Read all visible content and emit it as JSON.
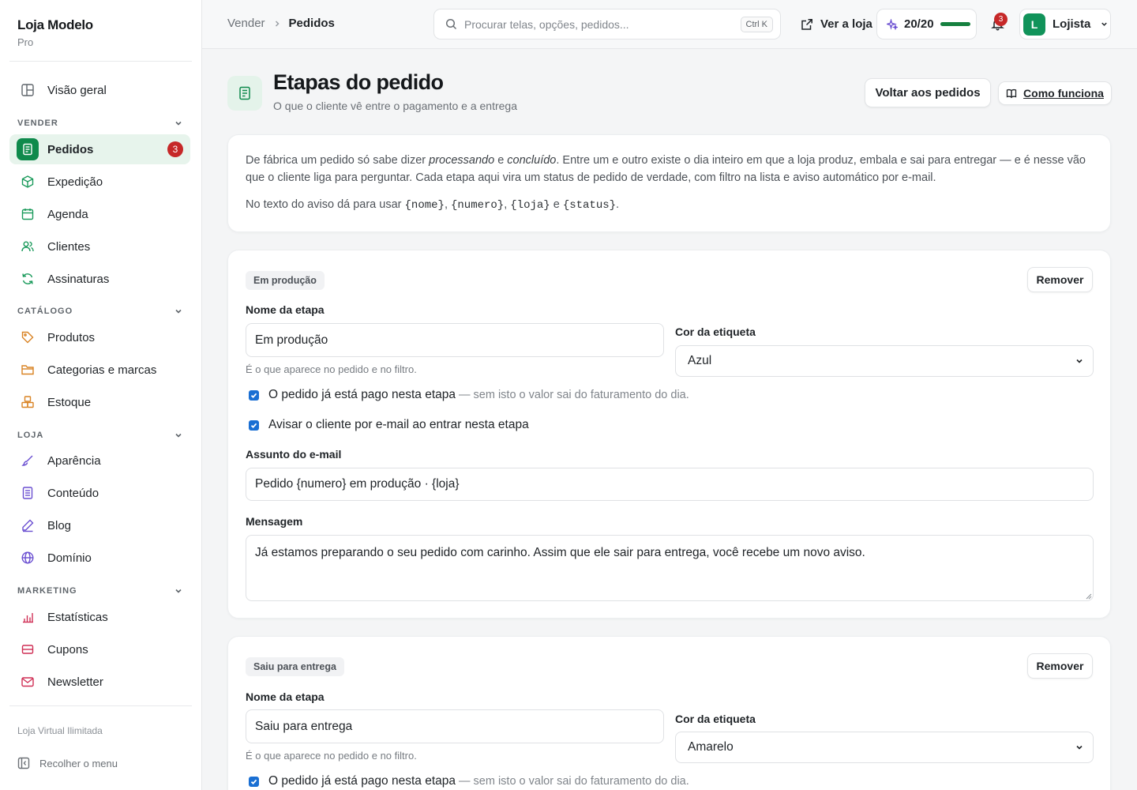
{
  "app": {
    "name": "Loja Modelo",
    "plan": "Pro"
  },
  "sidebar": {
    "overview": {
      "label": "Visão geral",
      "icon": "layout-icon"
    },
    "sections": [
      {
        "title": "VENDER",
        "items": [
          {
            "label": "Pedidos",
            "icon": "receipt-icon",
            "badge": "3",
            "active": true
          },
          {
            "label": "Expedição",
            "icon": "box-icon"
          },
          {
            "label": "Agenda",
            "icon": "calendar-icon"
          },
          {
            "label": "Clientes",
            "icon": "users-icon"
          },
          {
            "label": "Assinaturas",
            "icon": "refresh-icon"
          }
        ]
      },
      {
        "title": "CATÁLOGO",
        "items": [
          {
            "label": "Produtos",
            "icon": "tag-icon"
          },
          {
            "label": "Categorias e marcas",
            "icon": "folder-icon"
          },
          {
            "label": "Estoque",
            "icon": "boxes-icon"
          }
        ]
      },
      {
        "title": "LOJA",
        "items": [
          {
            "label": "Aparência",
            "icon": "brush-icon"
          },
          {
            "label": "Conteúdo",
            "icon": "document-icon"
          },
          {
            "label": "Blog",
            "icon": "pen-icon"
          },
          {
            "label": "Domínio",
            "icon": "globe-icon"
          }
        ]
      },
      {
        "title": "MARKETING",
        "items": [
          {
            "label": "Estatísticas",
            "icon": "bar-chart-icon"
          },
          {
            "label": "Cupons",
            "icon": "ticket-icon"
          },
          {
            "label": "Newsletter",
            "icon": "mail-icon"
          }
        ]
      }
    ],
    "footer_text": "Loja Virtual Ilimitada",
    "collapse_label": "Recolher o menu"
  },
  "topbar": {
    "breadcrumb": [
      "Vender",
      "Pedidos"
    ],
    "search_placeholder": "Procurar telas, opções, pedidos...",
    "search_shortcut": "Ctrl K",
    "view_store": "Ver a loja",
    "quota": "20/20",
    "quota_fraction": 1.0,
    "notifications": "3",
    "user": {
      "initial": "L",
      "name": "Lojista"
    }
  },
  "page": {
    "title": "Etapas do pedido",
    "subtitle": "O que o cliente vê entre o pagamento e a entrega",
    "back_button": "Voltar aos pedidos",
    "help_button": "Como funciona"
  },
  "intro": {
    "p1_a": "De fábrica um pedido só sabe dizer ",
    "p1_em1": "processando",
    "p1_b": " e ",
    "p1_em2": "concluído",
    "p1_c": ". Entre um e outro existe o dia inteiro em que a loja produz, embala e sai para entregar — e é nesse vão que o cliente liga para perguntar. Cada etapa aqui vira um status de pedido de verdade, com filtro na lista e aviso automático por e-mail.",
    "p2_a": "No texto do aviso dá para usar ",
    "vars": [
      "{nome}",
      "{numero}",
      "{loja}",
      "{status}"
    ],
    "sep": ", ",
    "and": " e ",
    "end": "."
  },
  "stage_labels": {
    "remove": "Remover",
    "name_label": "Nome da etapa",
    "name_hint": "É o que aparece no pedido e no filtro.",
    "color_label": "Cor da etiqueta",
    "paid_label": "O pedido já está pago nesta etapa",
    "paid_hint": "— sem isto o valor sai do faturamento do dia.",
    "notify_label": "Avisar o cliente por e-mail ao entrar nesta etapa",
    "subject_label": "Assunto do e-mail",
    "message_label": "Mensagem"
  },
  "stages": [
    {
      "tag": "Em produção",
      "name": "Em produção",
      "color": "Azul",
      "paid": true,
      "notify": true,
      "subject": "Pedido {numero} em produção · {loja}",
      "message": "Já estamos preparando o seu pedido com carinho. Assim que ele sair para entrega, você recebe um novo aviso."
    },
    {
      "tag": "Saiu para entrega",
      "name": "Saiu para entrega",
      "color": "Amarelo",
      "paid": true
    }
  ],
  "colors": {
    "brand": "#0f8a4c",
    "badge": "#c62828",
    "checkbox": "#1a6fd3"
  }
}
